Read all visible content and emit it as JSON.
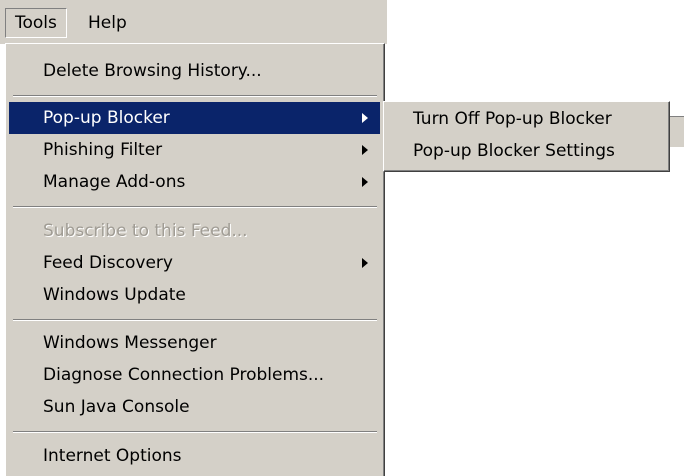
{
  "menubar": {
    "items": [
      {
        "label": "Tools"
      },
      {
        "label": "Help"
      }
    ]
  },
  "tools_menu": {
    "items": [
      {
        "label": "Delete Browsing History..."
      },
      {
        "label": "Pop-up Blocker"
      },
      {
        "label": "Phishing Filter"
      },
      {
        "label": "Manage Add-ons"
      },
      {
        "label": "Subscribe to this Feed..."
      },
      {
        "label": "Feed Discovery"
      },
      {
        "label": "Windows Update"
      },
      {
        "label": "Windows Messenger"
      },
      {
        "label": "Diagnose Connection Problems..."
      },
      {
        "label": "Sun Java Console"
      },
      {
        "label": "Internet Options"
      }
    ]
  },
  "popup_submenu": {
    "items": [
      {
        "label": "Turn Off Pop-up Blocker"
      },
      {
        "label": "Pop-up Blocker Settings"
      }
    ]
  },
  "colors": {
    "menu_bg": "#d4d0c8",
    "highlight": "#0a246a",
    "disabled_text": "#a09c94"
  },
  "icons": [
    "submenu-arrow-icon"
  ]
}
